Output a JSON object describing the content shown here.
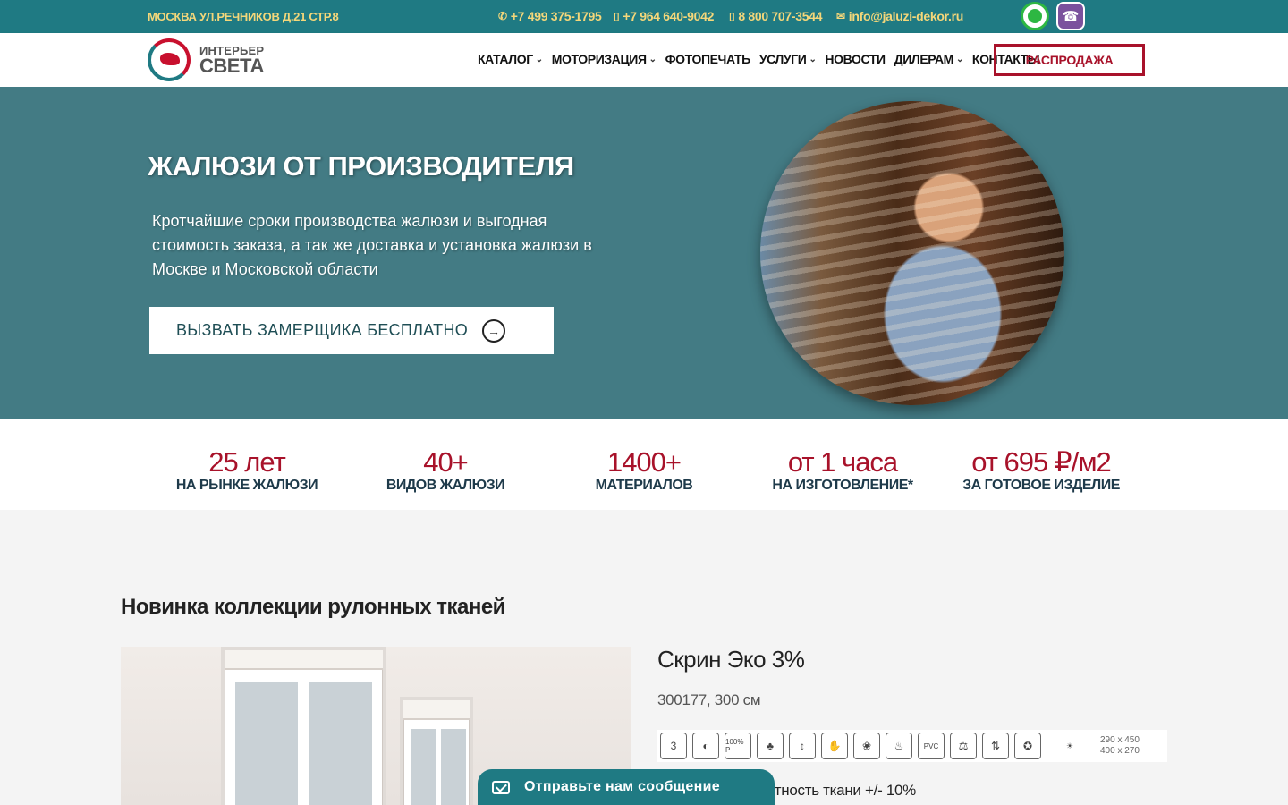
{
  "topbar": {
    "address": "МОСКВА УЛ.РЕЧНИКОВ Д.21 СТР.8",
    "phone1": "+7 499 375-1795",
    "phone2": "+7 964 640-9042",
    "phone3": "8 800 707-3544",
    "email": "info@jaluzi-dekor.ru",
    "messengers": [
      "whatsapp-icon",
      "viber-icon"
    ],
    "color": "#1f7a83",
    "text_color": "#f4d77a"
  },
  "header": {
    "logo_line1": "ИНТЕРЬЕР",
    "logo_line2": "СВЕТА",
    "nav": [
      {
        "label": "КАТАЛОГ",
        "has_dropdown": true
      },
      {
        "label": "МОТОРИЗАЦИЯ",
        "has_dropdown": true
      },
      {
        "label": "ФОТОПЕЧАТЬ",
        "has_dropdown": false
      },
      {
        "label": "УСЛУГИ",
        "has_dropdown": true
      },
      {
        "label": "НОВОСТИ",
        "has_dropdown": false
      },
      {
        "label": "ДИЛЕРАМ",
        "has_dropdown": true
      },
      {
        "label": "КОНТАКТЫ",
        "has_dropdown": false
      }
    ],
    "sale_button": "РАСПРОДАЖА",
    "accent": "#a8122a"
  },
  "hero": {
    "title": "ЖАЛЮЗИ ОТ ПРОИЗВОДИТЕЛЯ",
    "lead": "Кротчайшие сроки производства жалюзи и выгодная стоимость заказа, а так же доставка и установка жалюзи в Москве и Московской области",
    "cta": "ВЫЗВАТЬ ЗАМЕРЩИКА БЕСПЛАТНО",
    "background": "#437b84"
  },
  "stats": [
    {
      "value": "25 лет",
      "label": "НА РЫНКЕ ЖАЛЮЗИ"
    },
    {
      "value": "40+",
      "label": "ВИДОВ ЖАЛЮЗИ"
    },
    {
      "value": "1400+",
      "label": "МАТЕРИАЛОВ"
    },
    {
      "value": "от 1 часа",
      "label": "НА ИЗГОТОВЛЕНИЕ*"
    },
    {
      "value": "от 695 ₽/м2",
      "label": "ЗА ГОТОВОЕ ИЗДЕЛИЕ"
    }
  ],
  "collection": {
    "title": "Новинка коллекции рулонных тканей",
    "product_name": "Скрин Эко 3%",
    "product_code": "300177, 300 см",
    "feature_icons": [
      "3",
      "half-circle-icon",
      "100% P",
      "clover-icon",
      "height-300-icon",
      "hand-wash-icon",
      "leaves-icon",
      "fire-icon",
      "pvc-icon",
      "weight-icon",
      "thickness-icon",
      "certificate-icon",
      "oeko-tex-icon"
    ],
    "sizes": [
      "290 x 450",
      "400 x 270"
    ],
    "density": "отность ткани +/- 10%"
  },
  "chat": {
    "label": "Отправьте нам сообщение"
  }
}
